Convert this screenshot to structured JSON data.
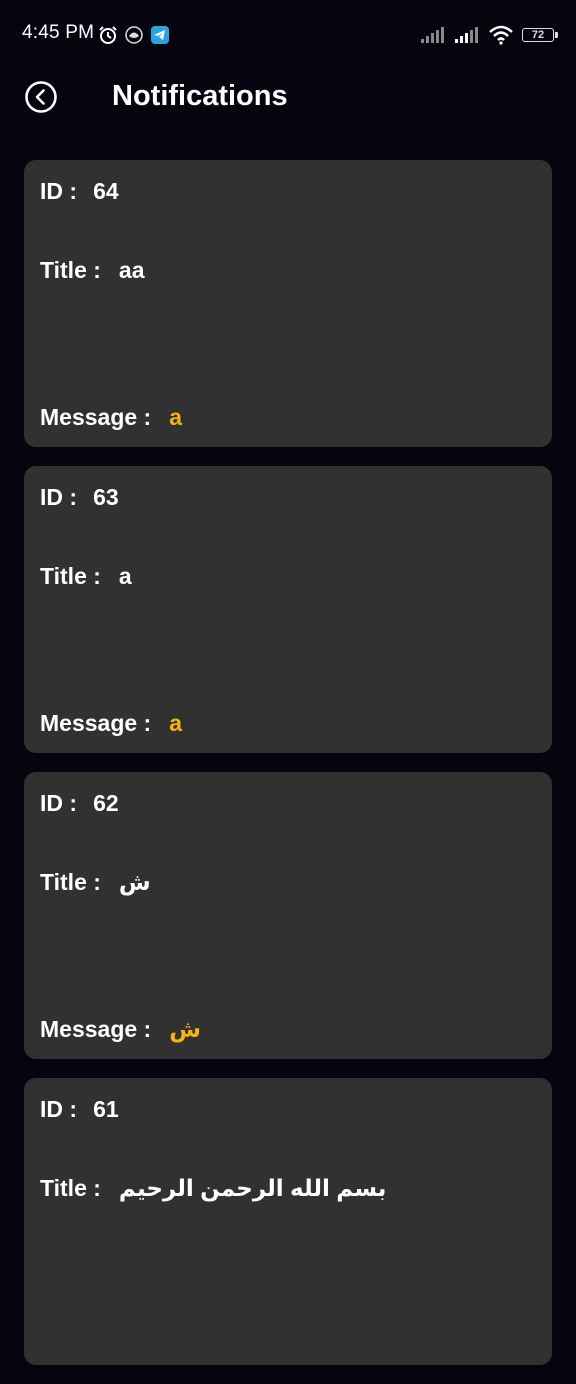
{
  "status_bar": {
    "time": "4:45 PM",
    "battery": "72"
  },
  "header": {
    "title": "Notifications"
  },
  "labels": {
    "id": "ID :",
    "title": "Title :",
    "message": "Message :"
  },
  "notifications": [
    {
      "id": "64",
      "title": "aa",
      "message": "a"
    },
    {
      "id": "63",
      "title": "a",
      "message": "a"
    },
    {
      "id": "62",
      "title": "ش",
      "message": "ش"
    },
    {
      "id": "61",
      "title": "بسم الله الرحمن الرحيم",
      "message": ""
    }
  ],
  "colors": {
    "background": "#05050f",
    "card": "#313131",
    "message_accent": "#f4b40e"
  }
}
